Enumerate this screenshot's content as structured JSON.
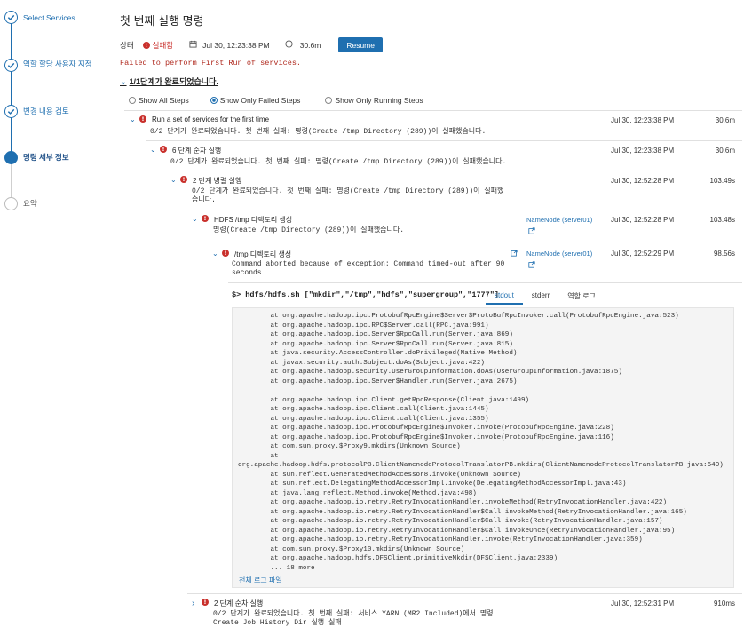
{
  "sidebar": {
    "steps": [
      {
        "label": "Select Services",
        "state": "done"
      },
      {
        "label": "역할 할당 사용자 지정",
        "state": "done"
      },
      {
        "label": "변경 내용 검토",
        "state": "done"
      },
      {
        "label": "명령 세부 정보",
        "state": "current"
      },
      {
        "label": "요약",
        "state": "todo"
      }
    ]
  },
  "header": {
    "title": "첫 번째 실행 명령",
    "status_label": "상태",
    "status_value": "실패함",
    "date": "Jul 30, 12:23:38 PM",
    "duration": "30.6m",
    "resume_label": "Resume",
    "fail_message": "Failed to perform First Run of services.",
    "completed_text": "1/1단계가 완료되었습니다."
  },
  "filters": [
    {
      "label": "Show All Steps",
      "selected": false
    },
    {
      "label": "Show Only Failed Steps",
      "selected": true
    },
    {
      "label": "Show Only Running Steps",
      "selected": false
    }
  ],
  "steps": [
    {
      "title": "Run a set of services for the first time",
      "sub": "0/2 단계가 완료되었습니다. 첫 번째 실패: 명령(Create /tmp Directory (289))이 실패했습니다.",
      "date": "Jul 30, 12:23:38 PM",
      "duration": "30.6m"
    },
    {
      "title": "6 단계 순차 실행",
      "sub": "0/2 단계가 완료되었습니다. 첫 번째 실패: 명령(Create /tmp Directory (289))이 실패했습니다.",
      "date": "Jul 30, 12:23:38 PM",
      "duration": "30.6m"
    },
    {
      "title": "2 단계 병렬 실행",
      "sub": "0/2 단계가 완료되었습니다. 첫 번째 실패: 명령(Create /tmp Directory (289))이 실패했",
      "sub2": "습니다.",
      "date": "Jul 30, 12:52:28 PM",
      "duration": "103.49s"
    },
    {
      "title": "HDFS /tmp 디렉토리 생성",
      "sub": "명령(Create /tmp Directory (289))이 실패했습니다.",
      "host": "NameNode (server01)",
      "date": "Jul 30, 12:52:28 PM",
      "duration": "103.48s"
    },
    {
      "title": "/tmp 디렉토리 생성",
      "sub": "Command aborted because of exception: Command timed-out after 90",
      "sub2": "seconds",
      "host": "NameNode (server01)",
      "date": "Jul 30, 12:52:29 PM",
      "duration": "98.56s"
    },
    {
      "title": "2 단계 순차 실행",
      "sub": "0/2 단계가 완료되었습니다. 첫 번째 실패: 서비스 YARN (MR2 Included)에서 명령",
      "sub2": "Create Job History Dir 실행 실패",
      "date": "Jul 30, 12:52:31 PM",
      "duration": "910ms"
    }
  ],
  "command": "$> hdfs/hdfs.sh [\"mkdir\",\"/tmp\",\"hdfs\",\"supergroup\",\"1777\"]",
  "log_tabs": [
    "stdout",
    "stderr",
    "역할 로그"
  ],
  "log_lines": [
    "        at org.apache.hadoop.ipc.ProtobufRpcEngine$Server$ProtoBufRpcInvoker.call(ProtobufRpcEngine.java:523)",
    "        at org.apache.hadoop.ipc.RPC$Server.call(RPC.java:991)",
    "        at org.apache.hadoop.ipc.Server$RpcCall.run(Server.java:869)",
    "        at org.apache.hadoop.ipc.Server$RpcCall.run(Server.java:815)",
    "        at java.security.AccessController.doPrivileged(Native Method)",
    "        at javax.security.auth.Subject.doAs(Subject.java:422)",
    "        at org.apache.hadoop.security.UserGroupInformation.doAs(UserGroupInformation.java:1875)",
    "        at org.apache.hadoop.ipc.Server$Handler.run(Server.java:2675)",
    "",
    "        at org.apache.hadoop.ipc.Client.getRpcResponse(Client.java:1499)",
    "        at org.apache.hadoop.ipc.Client.call(Client.java:1445)",
    "        at org.apache.hadoop.ipc.Client.call(Client.java:1355)",
    "        at org.apache.hadoop.ipc.ProtobufRpcEngine$Invoker.invoke(ProtobufRpcEngine.java:228)",
    "        at org.apache.hadoop.ipc.ProtobufRpcEngine$Invoker.invoke(ProtobufRpcEngine.java:116)",
    "        at com.sun.proxy.$Proxy9.mkdirs(Unknown Source)",
    "        at",
    "org.apache.hadoop.hdfs.protocolPB.ClientNamenodeProtocolTranslatorPB.mkdirs(ClientNamenodeProtocolTranslatorPB.java:640)",
    "        at sun.reflect.GeneratedMethodAccessor8.invoke(Unknown Source)",
    "        at sun.reflect.DelegatingMethodAccessorImpl.invoke(DelegatingMethodAccessorImpl.java:43)",
    "        at java.lang.reflect.Method.invoke(Method.java:498)",
    "        at org.apache.hadoop.io.retry.RetryInvocationHandler.invokeMethod(RetryInvocationHandler.java:422)",
    "        at org.apache.hadoop.io.retry.RetryInvocationHandler$Call.invokeMethod(RetryInvocationHandler.java:165)",
    "        at org.apache.hadoop.io.retry.RetryInvocationHandler$Call.invoke(RetryInvocationHandler.java:157)",
    "        at org.apache.hadoop.io.retry.RetryInvocationHandler$Call.invokeOnce(RetryInvocationHandler.java:95)",
    "        at org.apache.hadoop.io.retry.RetryInvocationHandler.invoke(RetryInvocationHandler.java:359)",
    "        at com.sun.proxy.$Proxy10.mkdirs(Unknown Source)",
    "        at org.apache.hadoop.hdfs.DFSClient.primitiveMkdir(DFSClient.java:2339)",
    "        ... 18 more"
  ],
  "full_log_link": "전체 로그 파일"
}
